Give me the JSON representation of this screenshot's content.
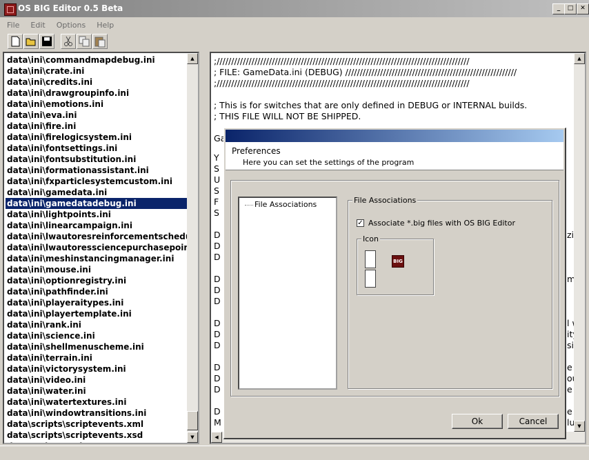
{
  "window": {
    "title": "OS BIG Editor 0.5 Beta"
  },
  "menu": [
    "File",
    "Edit",
    "Options",
    "Help"
  ],
  "toolbar": {
    "buttons": [
      "new-file-icon",
      "open-folder-icon",
      "save-disk-icon",
      "cut-scissors-icon",
      "copy-icon",
      "paste-icon"
    ]
  },
  "file_list": {
    "selected_index": 13,
    "items": [
      "data\\ini\\commandmapdebug.ini",
      "data\\ini\\crate.ini",
      "data\\ini\\credits.ini",
      "data\\ini\\drawgroupinfo.ini",
      "data\\ini\\emotions.ini",
      "data\\ini\\eva.ini",
      "data\\ini\\fire.ini",
      "data\\ini\\firelogicsystem.ini",
      "data\\ini\\fontsettings.ini",
      "data\\ini\\fontsubstitution.ini",
      "data\\ini\\formationassistant.ini",
      "data\\ini\\fxparticlesystemcustom.ini",
      "data\\ini\\gamedata.ini",
      "data\\ini\\gamedatadebug.ini",
      "data\\ini\\lightpoints.ini",
      "data\\ini\\linearcampaign.ini",
      "data\\ini\\lwautoresreinforcementschedule",
      "data\\ini\\lwautoressciencepurchasepointb",
      "data\\ini\\meshinstancingmanager.ini",
      "data\\ini\\mouse.ini",
      "data\\ini\\optionregistry.ini",
      "data\\ini\\pathfinder.ini",
      "data\\ini\\playeraitypes.ini",
      "data\\ini\\playertemplate.ini",
      "data\\ini\\rank.ini",
      "data\\ini\\science.ini",
      "data\\ini\\shellmenuscheme.ini",
      "data\\ini\\terrain.ini",
      "data\\ini\\victorysystem.ini",
      "data\\ini\\video.ini",
      "data\\ini\\water.ini",
      "data\\ini\\watertextures.ini",
      "data\\ini\\windowtransitions.ini",
      "data\\scripts\\scriptevents.xml",
      "data\\scripts\\scriptevents.xsd",
      "data\\scripts\\scriptevents.xsx"
    ]
  },
  "editor": {
    "lines": [
      ";///////////////////////////////////////////////////////////////////////////////////////",
      "; FILE: GameData.ini (DEBUG) ///////////////////////////////////////////////////////////",
      ";///////////////////////////////////////////////////////////////////////////////////////",
      "",
      "; This is for switches that are only defined in DEBUG or INTERNAL builds.",
      "; THIS FILE WILL NOT BE SHIPPED.",
      "",
      "Ga"
    ],
    "left_chars": [
      "Y",
      "S",
      "U",
      "S",
      "F",
      "S",
      "",
      "D",
      "D",
      "D",
      "",
      "D",
      "D",
      "D",
      "",
      "D",
      "D",
      "D",
      "",
      "D",
      "D",
      "D",
      "",
      "D",
      "M"
    ],
    "right_chars": [
      "",
      "",
      "",
      "",
      "",
      "",
      "",
      "zie",
      "",
      "",
      "",
      "mu",
      "",
      "",
      "",
      "l w",
      "ity",
      "sib",
      "",
      "e t",
      "ou",
      "e t",
      "",
      "e t",
      "lu"
    ]
  },
  "dialog": {
    "title": "Preferences",
    "subtitle": "Here you can set the settings of the program",
    "tree": [
      "File Associations"
    ],
    "group_title": "File Associations",
    "checkbox_label": "Associate *.big files with OS BIG Editor",
    "checkbox_checked": true,
    "icon_group_title": "Icon",
    "ok_label": "Ok",
    "cancel_label": "Cancel"
  }
}
